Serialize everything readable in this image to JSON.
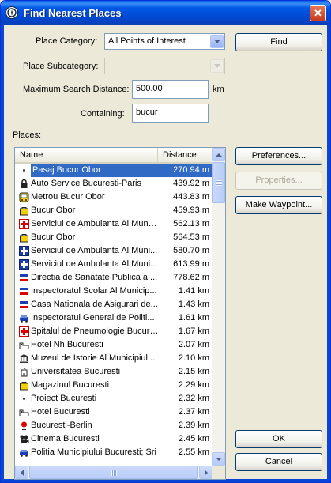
{
  "window": {
    "title": "Find Nearest Places",
    "close_symbol": "✕"
  },
  "form": {
    "category_label": "Place Category:",
    "category_value": "All Points of Interest",
    "subcategory_label": "Place Subcategory:",
    "subcategory_value": "",
    "distance_label": "Maximum Search Distance:",
    "distance_value": "500.00",
    "distance_unit": "km",
    "containing_label": "Containing:",
    "containing_value": "bucur",
    "places_label": "Places:"
  },
  "buttons": {
    "find": "Find",
    "preferences": "Preferences...",
    "properties": "Properties...",
    "make_waypoint": "Make Waypoint...",
    "ok": "OK",
    "cancel": "Cancel"
  },
  "list": {
    "columns": [
      "Name",
      "Distance"
    ],
    "rows": [
      {
        "icon": "dot-icon",
        "name": "Pasaj Bucur Obor",
        "distance": "270.94 m",
        "selected": true
      },
      {
        "icon": "lock-icon",
        "name": "Auto Service Bucuresti-Paris",
        "distance": "439.92 m"
      },
      {
        "icon": "bus-icon",
        "name": "Metrou Bucur Obor",
        "distance": "443.83 m"
      },
      {
        "icon": "shopping-bag-icon",
        "name": "Bucur Obor",
        "distance": "459.93 m"
      },
      {
        "icon": "red-cross-icon",
        "name": "Serviciul de Ambulanta Al Munici...",
        "distance": "562.13 m"
      },
      {
        "icon": "shopping-bag-icon",
        "name": "Bucur Obor",
        "distance": "564.53 m"
      },
      {
        "icon": "blue-cross-icon",
        "name": "Serviciul de Ambulanta Al Muni...",
        "distance": "580.70 m"
      },
      {
        "icon": "blue-cross-icon",
        "name": "Serviciul de Ambulanta Al Muni...",
        "distance": "613.99 m"
      },
      {
        "icon": "flag-icon",
        "name": "Directia de Sanatate Publica a ...",
        "distance": "778.62 m"
      },
      {
        "icon": "flag-icon",
        "name": "Inspectoratul Scolar Al Municip...",
        "distance": "1.41 km"
      },
      {
        "icon": "flag-icon",
        "name": "Casa Nationala de Asigurari de...",
        "distance": "1.43 km"
      },
      {
        "icon": "police-car-icon",
        "name": "Inspectoratul General de Politi...",
        "distance": "1.61 km"
      },
      {
        "icon": "red-cross-icon",
        "name": "Spitalul de Pneumologie Bucuresti",
        "distance": "1.67 km"
      },
      {
        "icon": "hotel-icon",
        "name": "Hotel Nh Bucuresti",
        "distance": "2.07 km"
      },
      {
        "icon": "museum-icon",
        "name": "Muzeul de Istorie Al Municipiul...",
        "distance": "2.10 km"
      },
      {
        "icon": "university-icon",
        "name": "Universitatea Bucuresti",
        "distance": "2.15 km"
      },
      {
        "icon": "shopping-bag-icon",
        "name": "Magazinul Bucuresti",
        "distance": "2.29 km"
      },
      {
        "icon": "dot-icon",
        "name": "Proiect Bucuresti",
        "distance": "2.32 km"
      },
      {
        "icon": "hotel-icon",
        "name": "Hotel Bucuresti",
        "distance": "2.37 km"
      },
      {
        "icon": "restaurant-icon",
        "name": "Bucuresti-Berlin",
        "distance": "2.39 km"
      },
      {
        "icon": "cinema-icon",
        "name": "Cinema Bucuresti",
        "distance": "2.45 km"
      },
      {
        "icon": "police-car-icon",
        "name": "Politia Municipiului Bucuresti; Sri",
        "distance": "2.55 km"
      }
    ]
  }
}
